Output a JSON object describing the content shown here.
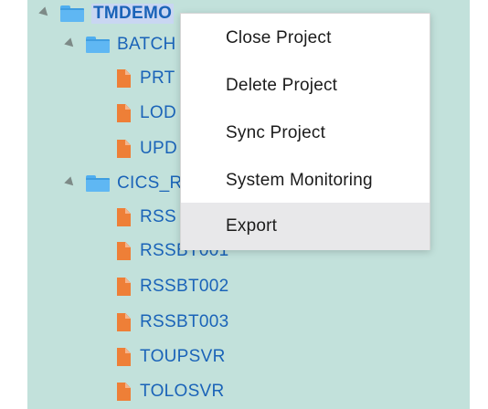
{
  "tree": {
    "root": {
      "label": "TMDEMO"
    },
    "folders": [
      {
        "label": "BATCH",
        "files": [
          "PRT",
          "LOD",
          "UPD"
        ]
      },
      {
        "label": "CICS_R",
        "files": [
          "RSS",
          "RSSBT001",
          "RSSBT002",
          "RSSBT003",
          "TOUPSVR",
          "TOLOSVR"
        ]
      }
    ]
  },
  "context_menu": {
    "items": [
      {
        "label": "Close Project"
      },
      {
        "label": "Delete Project"
      },
      {
        "label": "Sync Project"
      },
      {
        "label": "System Monitoring"
      },
      {
        "label": "Export"
      }
    ],
    "highlighted_item": "Export"
  },
  "colors": {
    "panel_background": "#c2e1db",
    "tree_text": "#1a63b8",
    "folder_icon": "#5fb7f3",
    "file_icon": "#ee7f37",
    "menu_highlight": "#e8e8ea"
  }
}
